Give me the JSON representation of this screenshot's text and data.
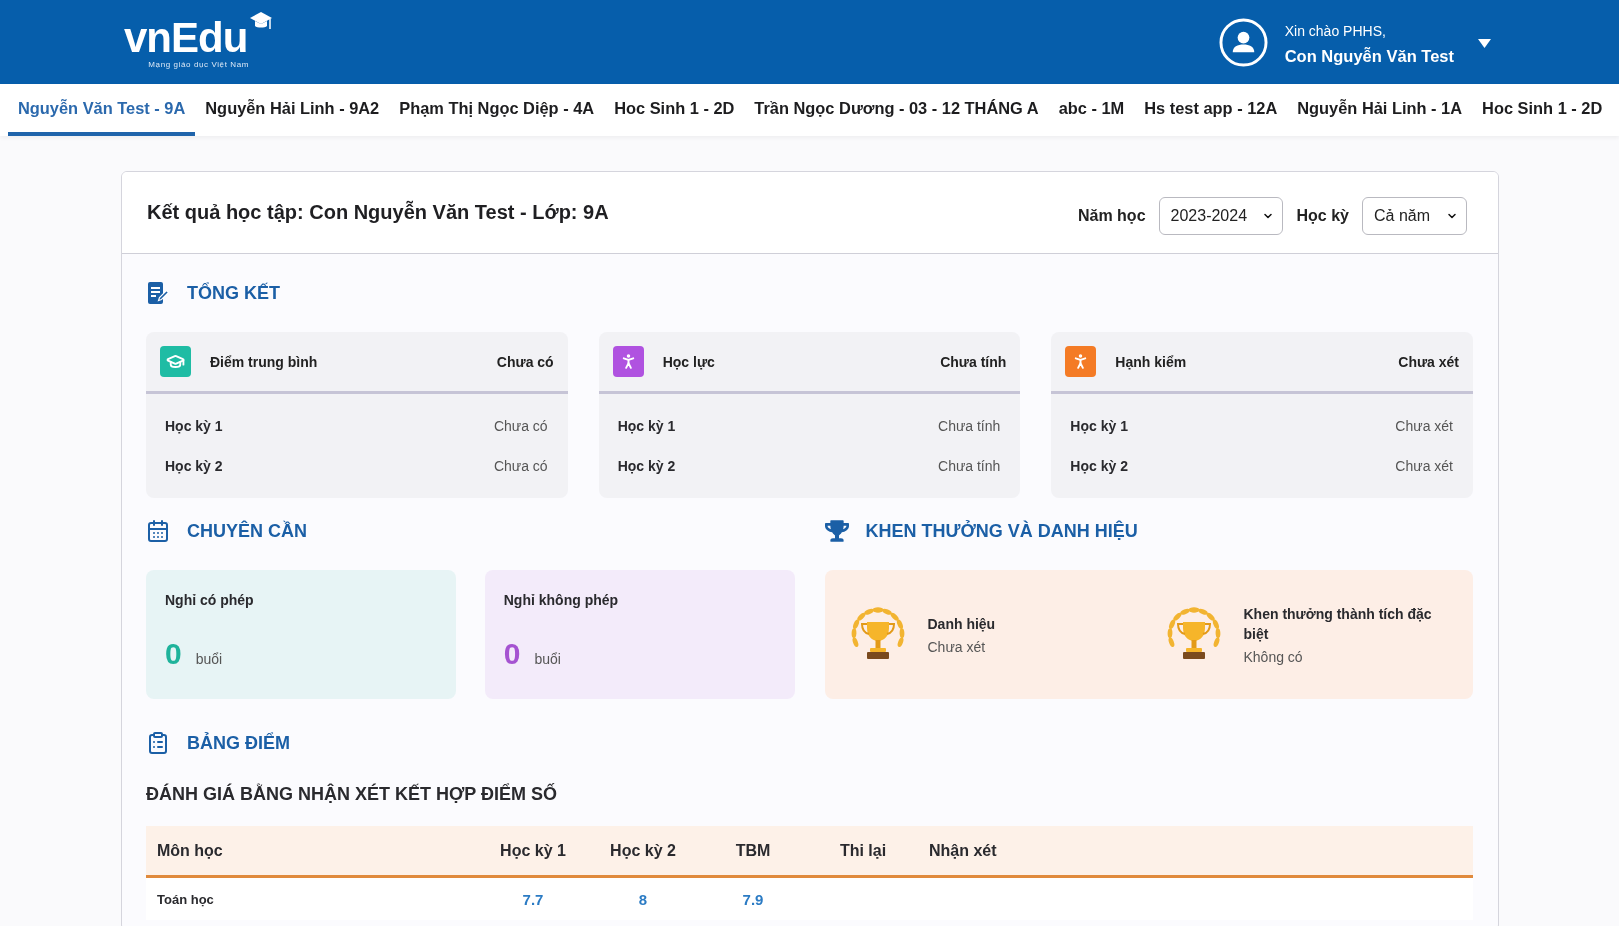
{
  "header": {
    "logo": {
      "name": "vnEdu",
      "tagline": "Mạng giáo dục Việt Nam"
    },
    "user": {
      "greeting": "Xin chào PHHS,",
      "name": "Con Nguyễn Văn Test"
    }
  },
  "student_tabs": [
    {
      "label": "Nguyễn Văn Test - 9A",
      "selected": true
    },
    {
      "label": "Nguyễn Hải Linh - 9A2",
      "selected": false
    },
    {
      "label": "Phạm Thị Ngọc Diệp - 4A",
      "selected": false
    },
    {
      "label": "Hoc Sinh 1 - 2D",
      "selected": false
    },
    {
      "label": "Trần Ngọc Dương - 03 - 12 THÁNG A",
      "selected": false
    },
    {
      "label": "abc - 1M",
      "selected": false
    },
    {
      "label": "Hs test app - 12A",
      "selected": false
    },
    {
      "label": "Nguyễn Hải Linh - 1A",
      "selected": false
    },
    {
      "label": "Hoc Sinh 1 - 2D",
      "selected": false
    }
  ],
  "results": {
    "title": "Kết quả học tập: Con Nguyễn Văn Test - Lớp: 9A",
    "filters": [
      {
        "label": "Năm học",
        "value": "2023-2024"
      },
      {
        "label": "Học kỳ",
        "value": "Cả năm"
      }
    ],
    "summary": {
      "heading": "TỔNG KẾT",
      "cards": [
        {
          "kind": "average",
          "title": "Điểm trung bình",
          "value": "Chưa có",
          "color": "#1fbca4",
          "rows": [
            {
              "label": "Học kỳ 1",
              "value": "Chưa có"
            },
            {
              "label": "Học kỳ 2",
              "value": "Chưa có"
            }
          ]
        },
        {
          "kind": "academic",
          "title": "Học lực",
          "value": "Chưa tính",
          "color": "#b052e0",
          "rows": [
            {
              "label": "Học kỳ 1",
              "value": "Chưa tính"
            },
            {
              "label": "Học kỳ 2",
              "value": "Chưa tính"
            }
          ]
        },
        {
          "kind": "conduct",
          "title": "Hạnh kiểm",
          "value": "Chưa xét",
          "color": "#f47b25",
          "rows": [
            {
              "label": "Học kỳ 1",
              "value": "Chưa xét"
            },
            {
              "label": "Học kỳ 2",
              "value": "Chưa xét"
            }
          ]
        }
      ]
    },
    "attendance": {
      "heading": "CHUYÊN CẦN",
      "items": [
        {
          "label": "Nghỉ có phép",
          "count": "0",
          "unit": "buổi",
          "color": "#1fb39b"
        },
        {
          "label": "Nghỉ không phép",
          "count": "0",
          "unit": "buổi",
          "color": "#a553d1"
        }
      ]
    },
    "awards": {
      "heading": "KHEN THƯỞNG VÀ DANH HIỆU",
      "items": [
        {
          "title": "Danh hiệu",
          "value": "Chưa xét"
        },
        {
          "title": "Khen thưởng thành tích đặc biệt",
          "value": "Không có"
        }
      ]
    },
    "grades": {
      "heading": "BẢNG ĐIỂM",
      "subtitle": "ĐÁNH GIÁ BẰNG NHẬN XÉT KẾT HỢP ĐIỂM SỐ",
      "columns": [
        "Môn học",
        "Học kỳ 1",
        "Học kỳ 2",
        "TBM",
        "Thi lại",
        "Nhận xét"
      ],
      "rows": [
        {
          "cells": [
            "Toán học",
            "7.7",
            "8",
            "7.9"
          ]
        }
      ]
    }
  }
}
